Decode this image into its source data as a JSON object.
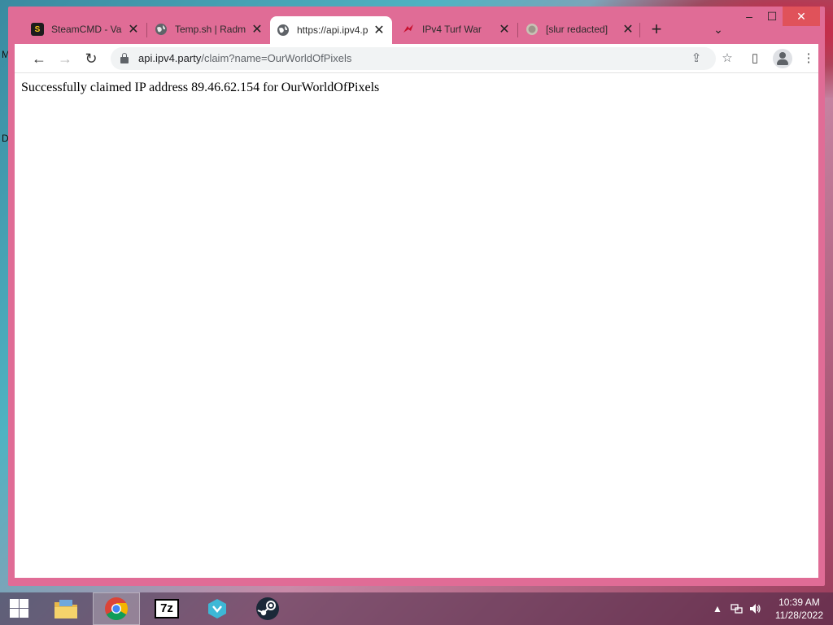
{
  "desktop": {
    "letter_top": "M",
    "letter_mid": "D"
  },
  "window_controls": {
    "minimize": "–",
    "maximize": "☐",
    "close": "✕"
  },
  "tabs": [
    {
      "title": "SteamCMD - Val",
      "favicon": "steamcmd-icon",
      "favicon_text": "S"
    },
    {
      "title": "Temp.sh | Radm",
      "favicon": "globe-icon"
    },
    {
      "title": "https://api.ipv4.p",
      "favicon": "globe-icon",
      "active": true
    },
    {
      "title": "IPv4 Turf War",
      "favicon": "turf-war-icon"
    },
    {
      "title": "[slur redacted]",
      "favicon": "coin-icon"
    }
  ],
  "tab_close_glyph": "✕",
  "new_tab_glyph": "+",
  "tab_search_glyph": "⌄",
  "nav": {
    "back": "←",
    "forward": "→",
    "reload": "↻"
  },
  "address_bar": {
    "host": "api.ipv4.party",
    "path": "/claim?name=OurWorldOfPixels"
  },
  "toolbar_icons": [
    "share-icon",
    "bookmark-star-icon",
    "side-panel-icon",
    "profile-icon",
    "menu-icon"
  ],
  "toolbar_glyphs": {
    "share": "⇪",
    "star": "☆",
    "sidepanel": "▯",
    "menu": "⋮"
  },
  "page": {
    "message": "Successfully claimed IP address 89.46.62.154 for OurWorldOfPixels"
  },
  "taskbar": {
    "apps": [
      "file-explorer-icon",
      "chrome-icon",
      "7zip-icon",
      "network-app-icon",
      "steam-icon"
    ],
    "sevenzip_label": "7z",
    "tray_arrow": "▲",
    "clock_time": "10:39 AM",
    "clock_date": "11/28/2022"
  },
  "colors": {
    "window_frame": "#e06c96",
    "close_button": "#e0525a",
    "page_background": "#ffffff"
  }
}
